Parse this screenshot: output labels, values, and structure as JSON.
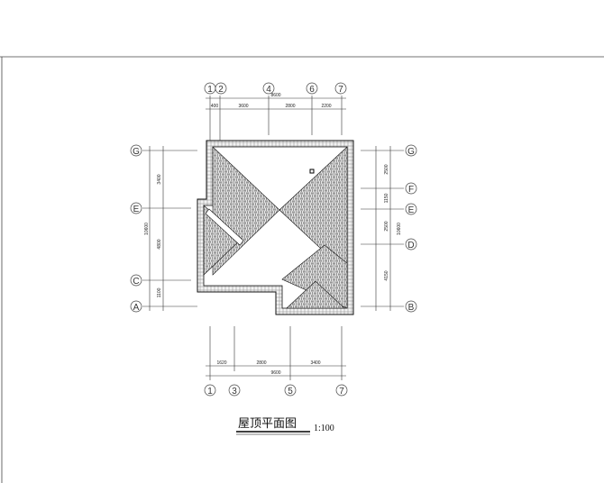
{
  "title": "屋顶平面图",
  "scale": "1:100",
  "axes": {
    "top": [
      "1",
      "2",
      "4",
      "6",
      "7"
    ],
    "bottom": [
      "1",
      "3",
      "5",
      "7"
    ],
    "left": [
      "G",
      "E",
      "C",
      "A"
    ],
    "right": [
      "G",
      "F",
      "E",
      "D",
      "B"
    ]
  },
  "dimensions": {
    "top_total": "8600",
    "top_segments": [
      "400",
      "3600",
      "2800",
      "2200"
    ],
    "bottom_total": "9600",
    "bottom_segments": [
      "1620",
      "2800",
      "3400"
    ],
    "left_total": "10600",
    "left_segments": [
      "3400",
      "4800",
      "1100"
    ],
    "right_total": "10600",
    "right_segments": [
      "2500",
      "1150",
      "2500",
      "4150"
    ]
  }
}
